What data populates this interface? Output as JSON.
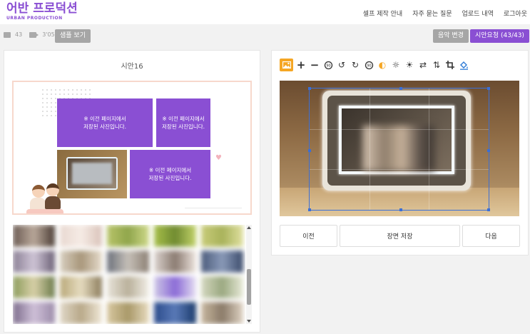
{
  "header": {
    "logo_main": "어반 프로덕션",
    "logo_sub": "URBAN PRODUCTION",
    "nav": [
      "셀프 제작 안내",
      "자주 묻는 질문",
      "업로드 내역",
      "로그아웃"
    ]
  },
  "toolbar": {
    "photo_count": "43",
    "video_length": "3'05\"",
    "sample_button": "샘플 보기",
    "music_button": "음악 변경",
    "order_button": "시안요청 (43/43)"
  },
  "scene": {
    "title": "시안16",
    "slot_text_line1": "※ 이전 페이지에서",
    "slot_text_line2": "저장된 사진입니다."
  },
  "editor": {
    "tool_icons": [
      "image-icon",
      "zoom-in-icon",
      "zoom-out-icon",
      "rotate-left-90-icon",
      "rotate-left-icon",
      "rotate-right-icon",
      "rotate-right-90-icon",
      "contrast-icon",
      "brightness-down-icon",
      "brightness-up-icon",
      "flip-horizontal-icon",
      "flip-vertical-icon",
      "crop-icon",
      "fill-icon"
    ],
    "prev_button": "이전",
    "save_button": "장면 저장",
    "next_button": "다음"
  },
  "colors": {
    "brand": "#8a4fd3",
    "accent": "#f5a623",
    "crop_border": "#3b6fd6"
  }
}
